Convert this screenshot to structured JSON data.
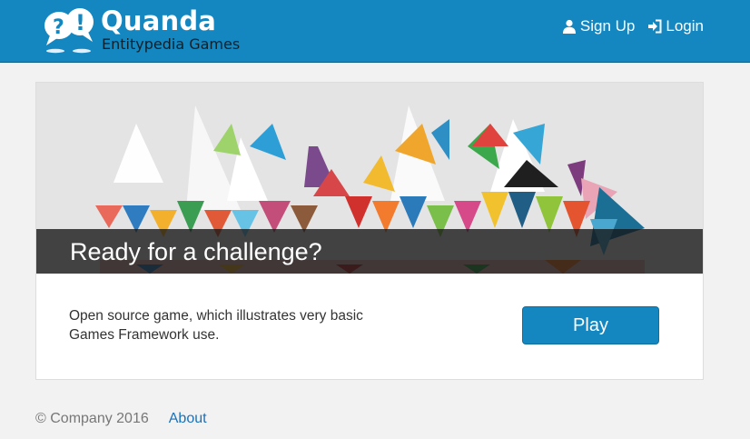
{
  "header": {
    "brand_name": "Quanda",
    "brand_subtitle": "Entitypedia Games",
    "nav": {
      "signup_label": "Sign Up",
      "login_label": "Login"
    }
  },
  "hero": {
    "title": "Ready for a challenge?"
  },
  "card": {
    "description": "Open source game, which illustrates very basic Games Framework use.",
    "play_label": "Play"
  },
  "footer": {
    "copyright": "© Company 2016",
    "about_label": "About"
  },
  "colors": {
    "navbar": "#1487c1",
    "play_button": "#1487c1",
    "link": "#1a72b8"
  },
  "icons": {
    "logo": "speech-bubbles-question-exclamation",
    "signup": "user-icon",
    "login": "login-icon"
  }
}
